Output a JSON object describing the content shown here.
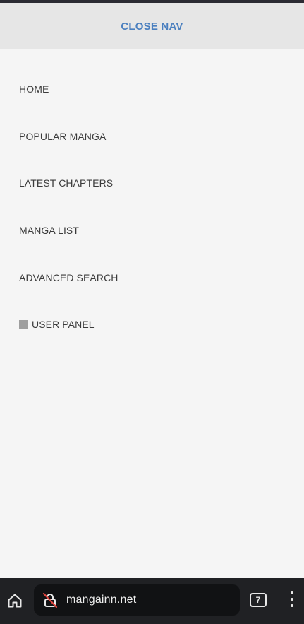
{
  "nav": {
    "close_label": "CLOSE NAV"
  },
  "menu": {
    "items": [
      {
        "label": "HOME"
      },
      {
        "label": "POPULAR MANGA"
      },
      {
        "label": "LATEST CHAPTERS"
      },
      {
        "label": "MANGA LIST"
      },
      {
        "label": "ADVANCED SEARCH"
      },
      {
        "label": "USER PANEL",
        "icon": "user-panel-square-icon"
      }
    ]
  },
  "browser": {
    "url": "mangainn.net",
    "tab_count": "7",
    "icons": {
      "home": "home-icon",
      "site_info": "not-secure-lock-icon",
      "tabs": "tabs-icon",
      "more": "more-vert-icon"
    },
    "colors": {
      "bar_background": "#202124",
      "url_pill": "#111214",
      "insecure_slash": "#e0443e"
    }
  },
  "colors": {
    "accent": "#4a7fbf",
    "menu_text": "#3b3b3b",
    "header_background": "#e6e6e6",
    "menu_background": "#f5f5f5"
  }
}
